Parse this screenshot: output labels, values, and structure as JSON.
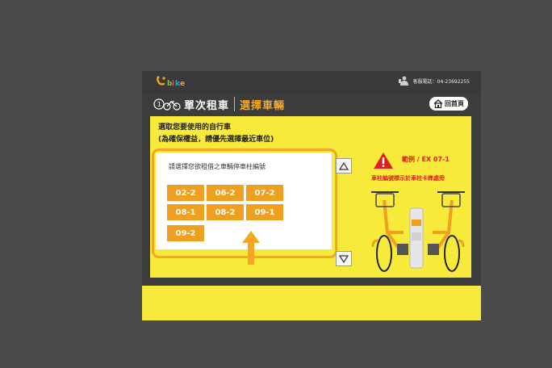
{
  "header": {
    "logo_text": "YouBike",
    "phone_label": "客服電話：04-23692255"
  },
  "titlebar": {
    "rental_mode": "單次租車",
    "step_title": "選擇車輛",
    "home_label": "回首頁"
  },
  "main": {
    "instruction_line1": "選取您要使用的自行車",
    "instruction_line2": "(為確保權益，請優先選擇最近車位)",
    "prompt": "請選擇您欲租借之車輛停車柱編號",
    "slots": [
      "02-2",
      "06-2",
      "07-2",
      "08-1",
      "08-2",
      "09-1",
      "09-2"
    ]
  },
  "example": {
    "label": "範例 / EX  07-1",
    "note": "車柱編號標示於車柱卡榫處旁"
  },
  "colors": {
    "panel_yellow": "#f7ea3a",
    "slot_orange": "#f0a020",
    "accent_orange": "#f5a623",
    "warning_red": "#e02020"
  },
  "icons": [
    "youbike-logo-icon",
    "phone-icon",
    "single-bike-icon",
    "home-icon",
    "scroll-up-icon",
    "scroll-down-icon",
    "pointer-arrow-icon",
    "warning-icon",
    "bikes-illustration"
  ]
}
